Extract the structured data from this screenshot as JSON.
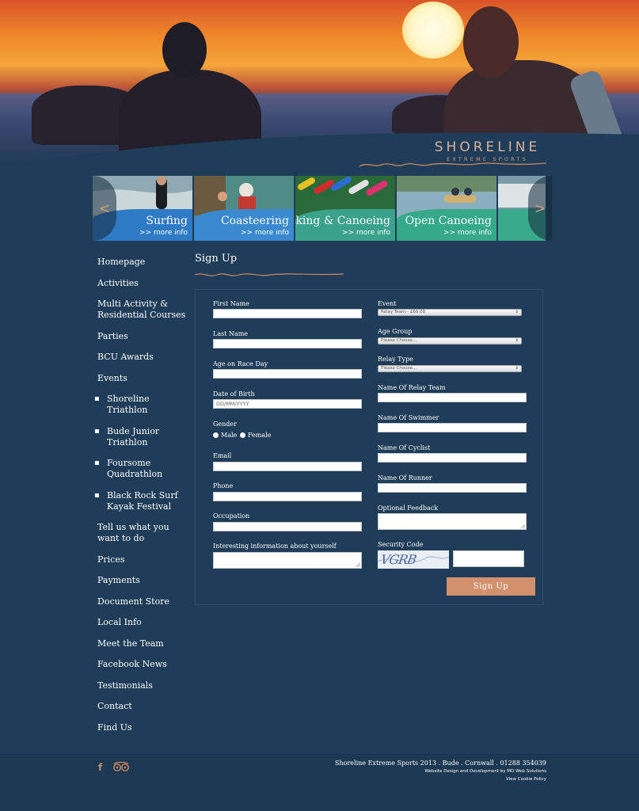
{
  "brand": {
    "logo_text": "SHORELINE",
    "logo_subtext": "EXTREME SPORTS",
    "accent_color": "#d2916c"
  },
  "carousel": {
    "prev_label": "<",
    "next_label": ">",
    "slides": [
      {
        "title": "Surfing",
        "more": ">> more info",
        "band_color": "#2f7ac4"
      },
      {
        "title": "Coasteering",
        "more": ">> more info",
        "band_color": "#3b8ad0"
      },
      {
        "title": "Kayaking & Canoeing",
        "more": ">> more info",
        "band_color": "#3aa28a"
      },
      {
        "title": "Open Canoeing",
        "more": ">> more info",
        "band_color": "#35a98a"
      }
    ]
  },
  "sidebar": {
    "items": [
      {
        "label": "Homepage"
      },
      {
        "label": "Activities"
      },
      {
        "label": "Multi Activity & Residential Courses"
      },
      {
        "label": "Parties"
      },
      {
        "label": "BCU Awards"
      },
      {
        "label": "Events"
      },
      {
        "label": "Shoreline Triathlon"
      },
      {
        "label": "Bude Junior Triathlon"
      },
      {
        "label": "Foursome Quadrathlon"
      },
      {
        "label": "Black Rock Surf Kayak Festival"
      },
      {
        "label": "Tell us what you want to do"
      },
      {
        "label": "Prices"
      },
      {
        "label": "Payments"
      },
      {
        "label": "Document Store"
      },
      {
        "label": "Local Info"
      },
      {
        "label": "Meet the Team"
      },
      {
        "label": "Facebook News"
      },
      {
        "label": "Testimonials"
      },
      {
        "label": "Contact"
      },
      {
        "label": "Find Us"
      }
    ]
  },
  "main": {
    "title": "Sign Up"
  },
  "form": {
    "left": {
      "first_name_label": "First Name",
      "last_name_label": "Last Name",
      "age_label": "Age on Race Day",
      "dob_label": "Date of Birth",
      "dob_placeholder": "DD/MM/YYYY",
      "gender_label": "Gender",
      "gender_male": "Male",
      "gender_female": "Female",
      "email_label": "Email",
      "phone_label": "Phone",
      "occupation_label": "Occupation",
      "info_label": "Interesting information about yourself"
    },
    "right": {
      "event_label": "Event",
      "event_value": "Relay Team - £60.00",
      "age_group_label": "Age Group",
      "age_group_value": "Please Choose...",
      "relay_type_label": "Relay Type",
      "relay_type_value": "Please Choose...",
      "relay_team_label": "Name Of Relay Team",
      "swimmer_label": "Name Of Swimmer",
      "cyclist_label": "Name Of Cyclist",
      "runner_label": "Name Of Runner",
      "feedback_label": "Optional Feedback",
      "security_label": "Security Code",
      "captcha_text": "VGRB"
    },
    "submit_label": "Sign Up"
  },
  "footer": {
    "main_text": "Shoreline Extreme Sports 2013 . Bude . Cornwall . 01288 354039",
    "credit_text": "Website Design and Development by MD Web Solutions",
    "cookie_text": "View Cookie Policy",
    "facebook_glyph": "f"
  }
}
